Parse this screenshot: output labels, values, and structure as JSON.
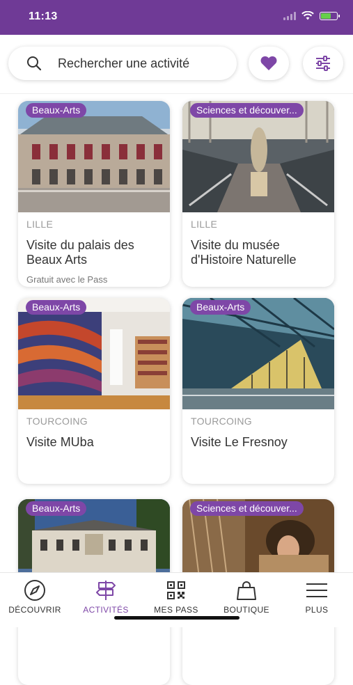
{
  "status_bar": {
    "time": "11:13"
  },
  "search": {
    "placeholder": "Rechercher une activité"
  },
  "colors": {
    "brand": "#6f3a96",
    "badge": "#7e47a7",
    "heart": "#7e47a7"
  },
  "icons": {
    "search": "search-icon",
    "favorites": "heart-icon",
    "filters": "sliders-icon"
  },
  "activities": [
    {
      "category": "Beaux-Arts",
      "city": "LILLE",
      "title": "Visite du palais des Beaux Arts",
      "note": "Gratuit avec le Pass"
    },
    {
      "category": "Sciences et découver...",
      "city": "LILLE",
      "title": "Visite du musée d'Histoire Naturelle",
      "note": ""
    },
    {
      "category": "Beaux-Arts",
      "city": "TOURCOING",
      "title": "Visite MUba",
      "note": ""
    },
    {
      "category": "Beaux-Arts",
      "city": "TOURCOING",
      "title": "Visite Le Fresnoy",
      "note": ""
    },
    {
      "category": "Beaux-Arts",
      "city": "",
      "title": "",
      "note": ""
    },
    {
      "category": "Sciences et découver...",
      "city": "",
      "title": "",
      "note": ""
    }
  ],
  "nav": [
    {
      "label": "DÉCOUVRIR",
      "icon": "compass-icon",
      "active": false
    },
    {
      "label": "ACTIVITÉS",
      "icon": "signpost-icon",
      "active": true
    },
    {
      "label": "MES PASS",
      "icon": "qr-code-icon",
      "active": false
    },
    {
      "label": "BOUTIQUE",
      "icon": "shopping-bag-icon",
      "active": false
    },
    {
      "label": "PLUS",
      "icon": "menu-icon",
      "active": false
    }
  ]
}
